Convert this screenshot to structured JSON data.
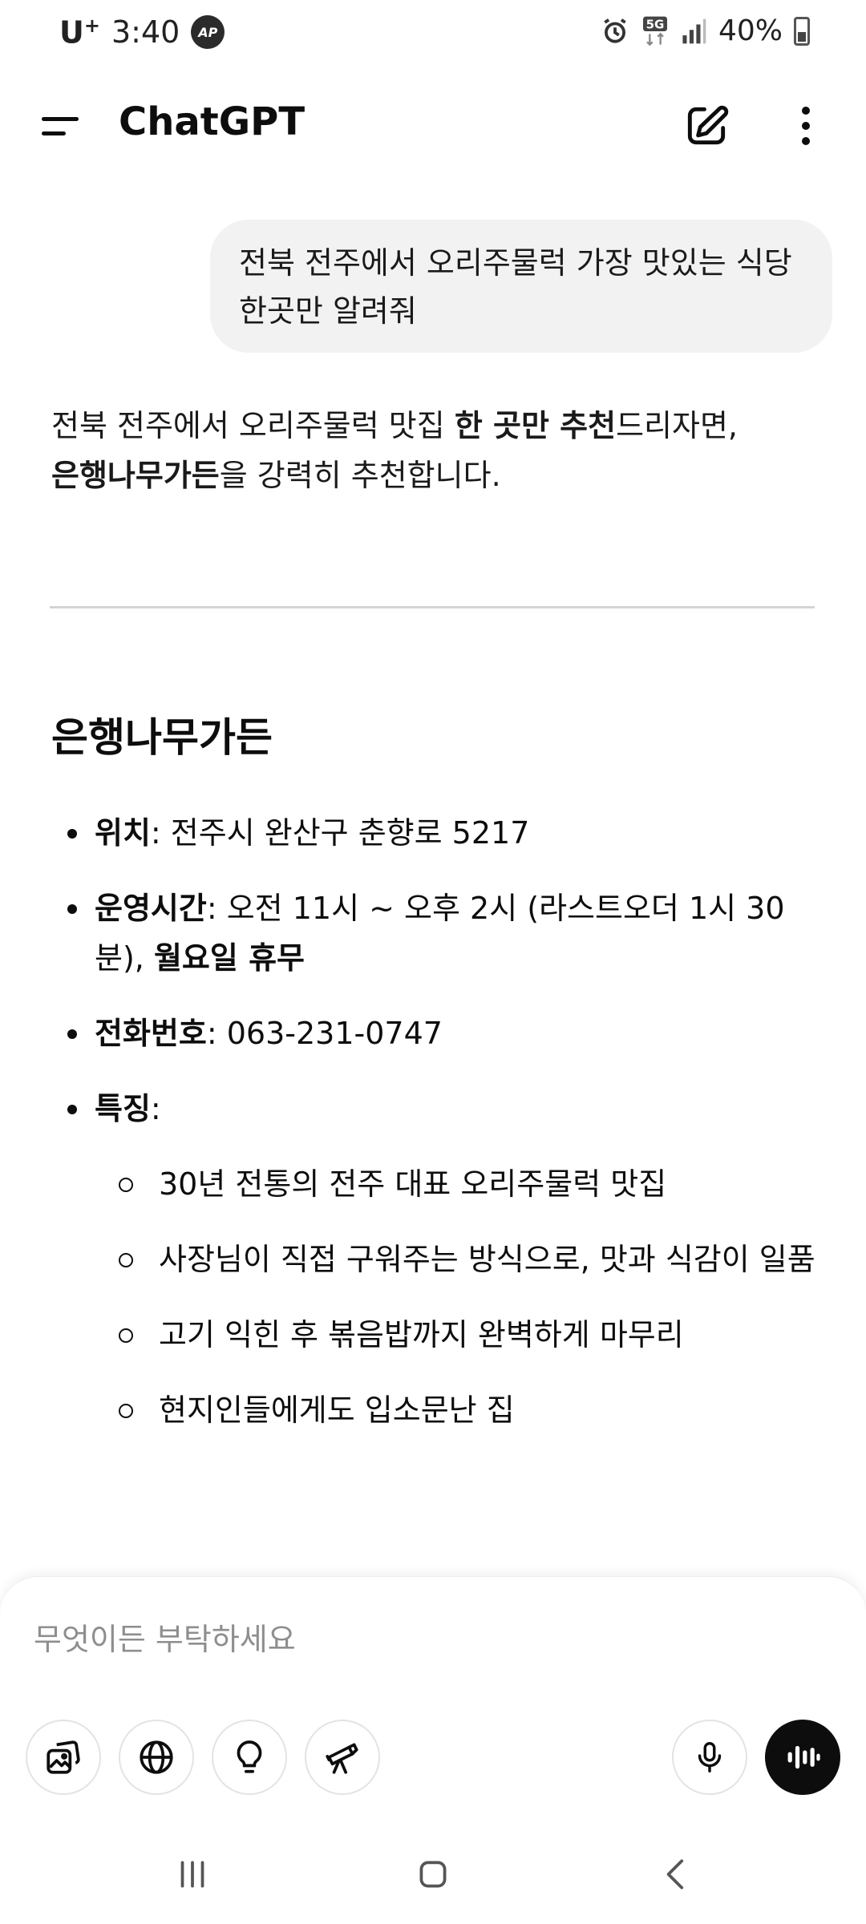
{
  "status_bar": {
    "carrier": "U",
    "carrier_plus": "+",
    "time": "3:40",
    "app_badge": "AP",
    "network": "5G",
    "battery": "40%"
  },
  "header": {
    "title": "ChatGPT"
  },
  "user_message": "전북 전주에서 오리주물럭 가장 맛있는 식당 한곳만 알려줘",
  "assistant": {
    "intro_part1": "전북 전주에서 오리주물럭 맛집 ",
    "intro_bold1": "한 곳만 추천",
    "intro_part2": "드리자면, ",
    "intro_bold2": "은행나무가든",
    "intro_part3": "을 강력히 추천합니다.",
    "restaurant_name": "은행나무가든",
    "location_label": "위치",
    "location_value": ": 전주시 완산구 춘향로 5217",
    "hours_label": "운영시간",
    "hours_value": ": 오전 11시 ~ 오후 2시 (라스트오더 1시 30분), ",
    "hours_closed": "월요일 휴무",
    "phone_label": "전화번호",
    "phone_value": ": 063-231-0747",
    "features_label": "특징",
    "features_colon": ":",
    "features": [
      "30년 전통의 전주 대표 오리주물럭 맛집",
      "사장님이 직접 구워주는 방식으로, 맛과 식감이 일품",
      "고기 익힌 후 볶음밥까지 완벽하게 마무리",
      "현지인들에게도 입소문난 집"
    ]
  },
  "composer": {
    "placeholder": "무엇이든 부탁하세요"
  }
}
